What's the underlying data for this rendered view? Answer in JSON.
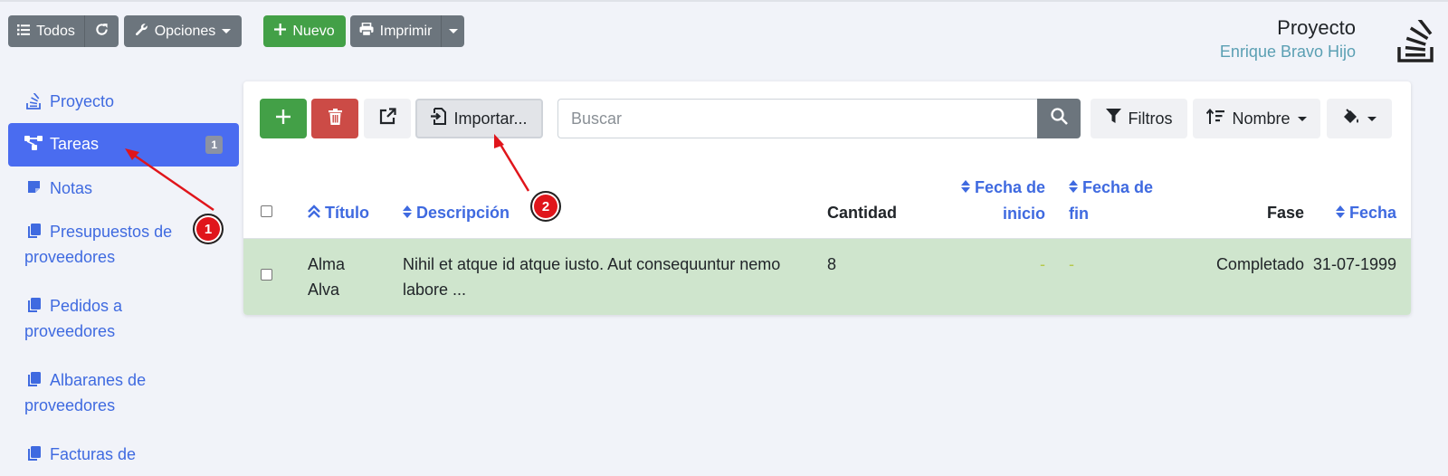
{
  "toolbar": {
    "todos_label": "Todos",
    "opciones_label": "Opciones",
    "nuevo_label": "Nuevo",
    "imprimir_label": "Imprimir"
  },
  "header": {
    "title": "Proyecto",
    "subtitle": "Enrique Bravo Hijo"
  },
  "sidebar": {
    "items": [
      {
        "label": "Proyecto",
        "icon": "project-icon"
      },
      {
        "label": "Tareas",
        "icon": "tasks-icon",
        "badge": "1"
      },
      {
        "label": "Notas",
        "icon": "note-icon"
      },
      {
        "label_line1": "Presupuestos de",
        "label_line2": "proveedores",
        "icon": "copy-icon"
      },
      {
        "label_line1": "Pedidos a",
        "label_line2": "proveedores",
        "icon": "copy-icon"
      },
      {
        "label_line1": "Albaranes de",
        "label_line2": "proveedores",
        "icon": "copy-icon"
      },
      {
        "label_line1": "Facturas de",
        "icon": "copy-icon"
      }
    ]
  },
  "panel": {
    "import_label": "Importar...",
    "search_placeholder": "Buscar",
    "filters_label": "Filtros",
    "sort_label": "Nombre"
  },
  "table": {
    "headers": {
      "titulo": "Título",
      "descripcion": "Descripción",
      "cantidad": "Cantidad",
      "fecha_inicio_1": "Fecha de",
      "fecha_inicio_2": "inicio",
      "fecha_fin_1": "Fecha de",
      "fecha_fin_2": "fin",
      "fase": "Fase",
      "fecha": "Fecha"
    },
    "rows": [
      {
        "titulo_1": "Alma",
        "titulo_2": "Alva",
        "descripcion_1": "Nihil et atque id atque iusto. Aut consequuntur nemo",
        "descripcion_2": "labore ...",
        "cantidad": "8",
        "fecha_inicio": "-",
        "fecha_fin": "-",
        "fase": "Completado",
        "fecha": "31-07-1999"
      }
    ]
  },
  "annotations": {
    "marker1": "1",
    "marker2": "2"
  },
  "colors": {
    "accent": "#4a6cf0",
    "success": "#43a047",
    "danger": "#cc4b46",
    "row_highlight": "#cfe5cd",
    "annotation": "#e0151b"
  }
}
